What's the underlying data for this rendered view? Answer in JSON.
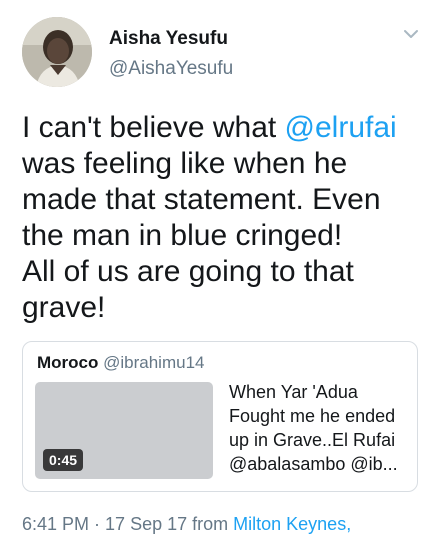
{
  "author": {
    "name": "Aisha Yesufu",
    "handle": "@AishaYesufu"
  },
  "tweet": {
    "text_part1": "I can't believe what ",
    "mention": "@elrufai",
    "text_part2": " was feeling like when he made that statement. Even the man in blue cringed!",
    "text_part3": "All of us are going to that grave!"
  },
  "quoted": {
    "name": "Moroco",
    "handle": "@ibrahimu14",
    "video_duration": "0:45",
    "text": "When Yar 'Adua Fought me he ended up in Grave..El Rufai @abalasambo @ib..."
  },
  "meta": {
    "time": "6:41 PM",
    "separator": " · ",
    "date": "17 Sep 17",
    "from": " from ",
    "place": "Milton Keynes,"
  },
  "icons": {
    "menu": "chevron-down-icon",
    "avatar": "profile-photo"
  },
  "colors": {
    "link": "#1da1f2",
    "secondary_text": "#657786",
    "primary_text": "#14171a",
    "border": "#d8dde2"
  }
}
